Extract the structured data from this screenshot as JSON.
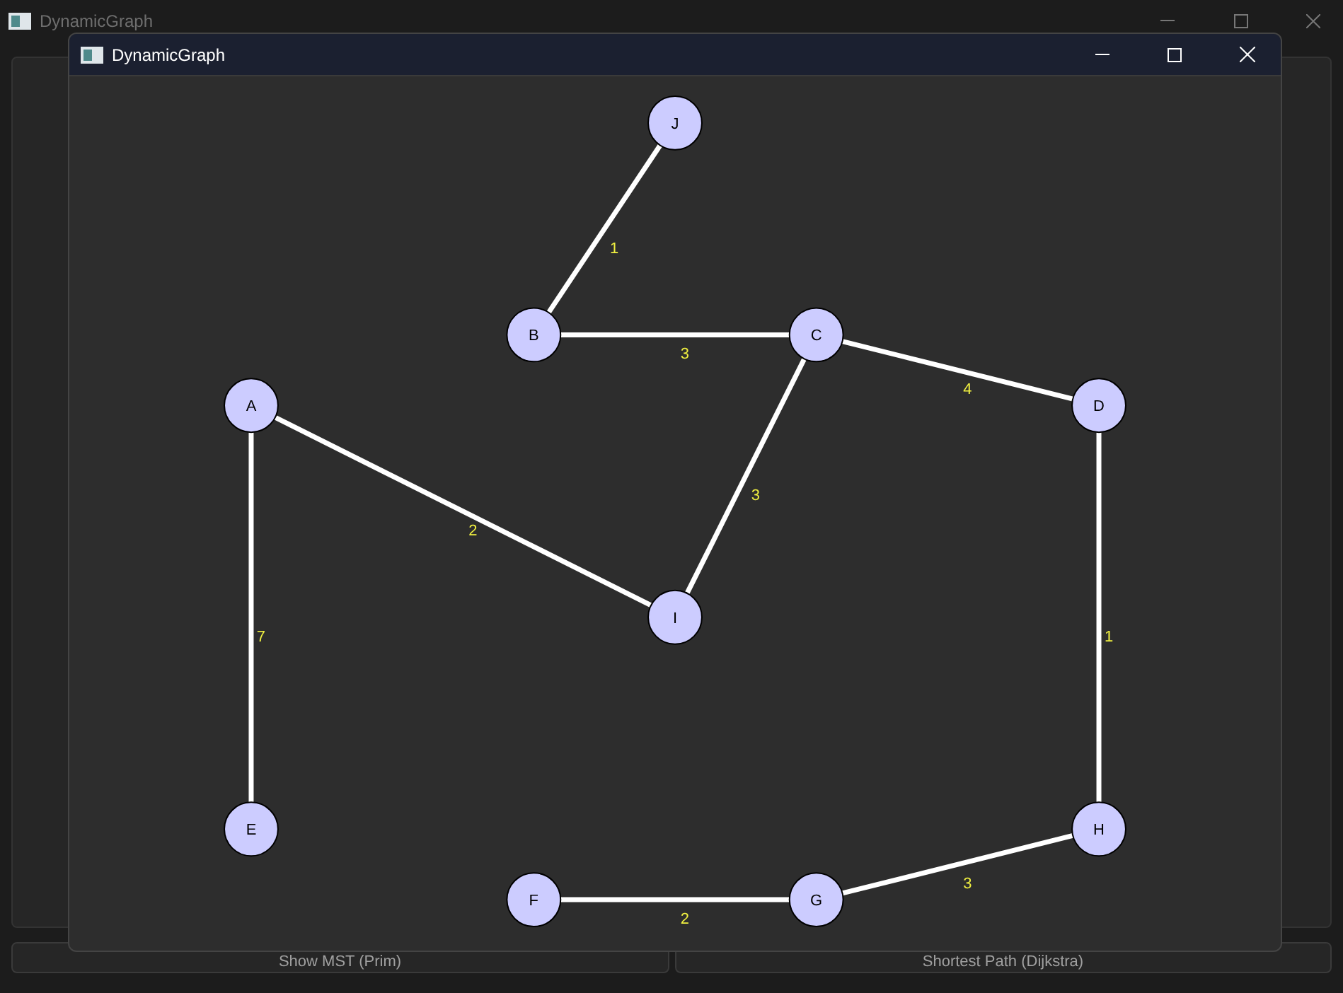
{
  "back_window": {
    "title": "DynamicGraph",
    "buttons": [
      "Show MST (Prim)",
      "Shortest Path (Dijkstra)"
    ]
  },
  "window": {
    "title": "DynamicGraph"
  },
  "graph": {
    "nodes": [
      {
        "label": "J"
      },
      {
        "label": "B"
      },
      {
        "label": "C"
      },
      {
        "label": "A"
      },
      {
        "label": "D"
      },
      {
        "label": "I"
      },
      {
        "label": "E"
      },
      {
        "label": "H"
      },
      {
        "label": "F"
      },
      {
        "label": "G"
      }
    ],
    "edges": [
      {
        "weight": "1"
      },
      {
        "weight": "3"
      },
      {
        "weight": "4"
      },
      {
        "weight": "2"
      },
      {
        "weight": "3"
      },
      {
        "weight": "7"
      },
      {
        "weight": "1"
      },
      {
        "weight": "2"
      },
      {
        "weight": "3"
      }
    ]
  }
}
